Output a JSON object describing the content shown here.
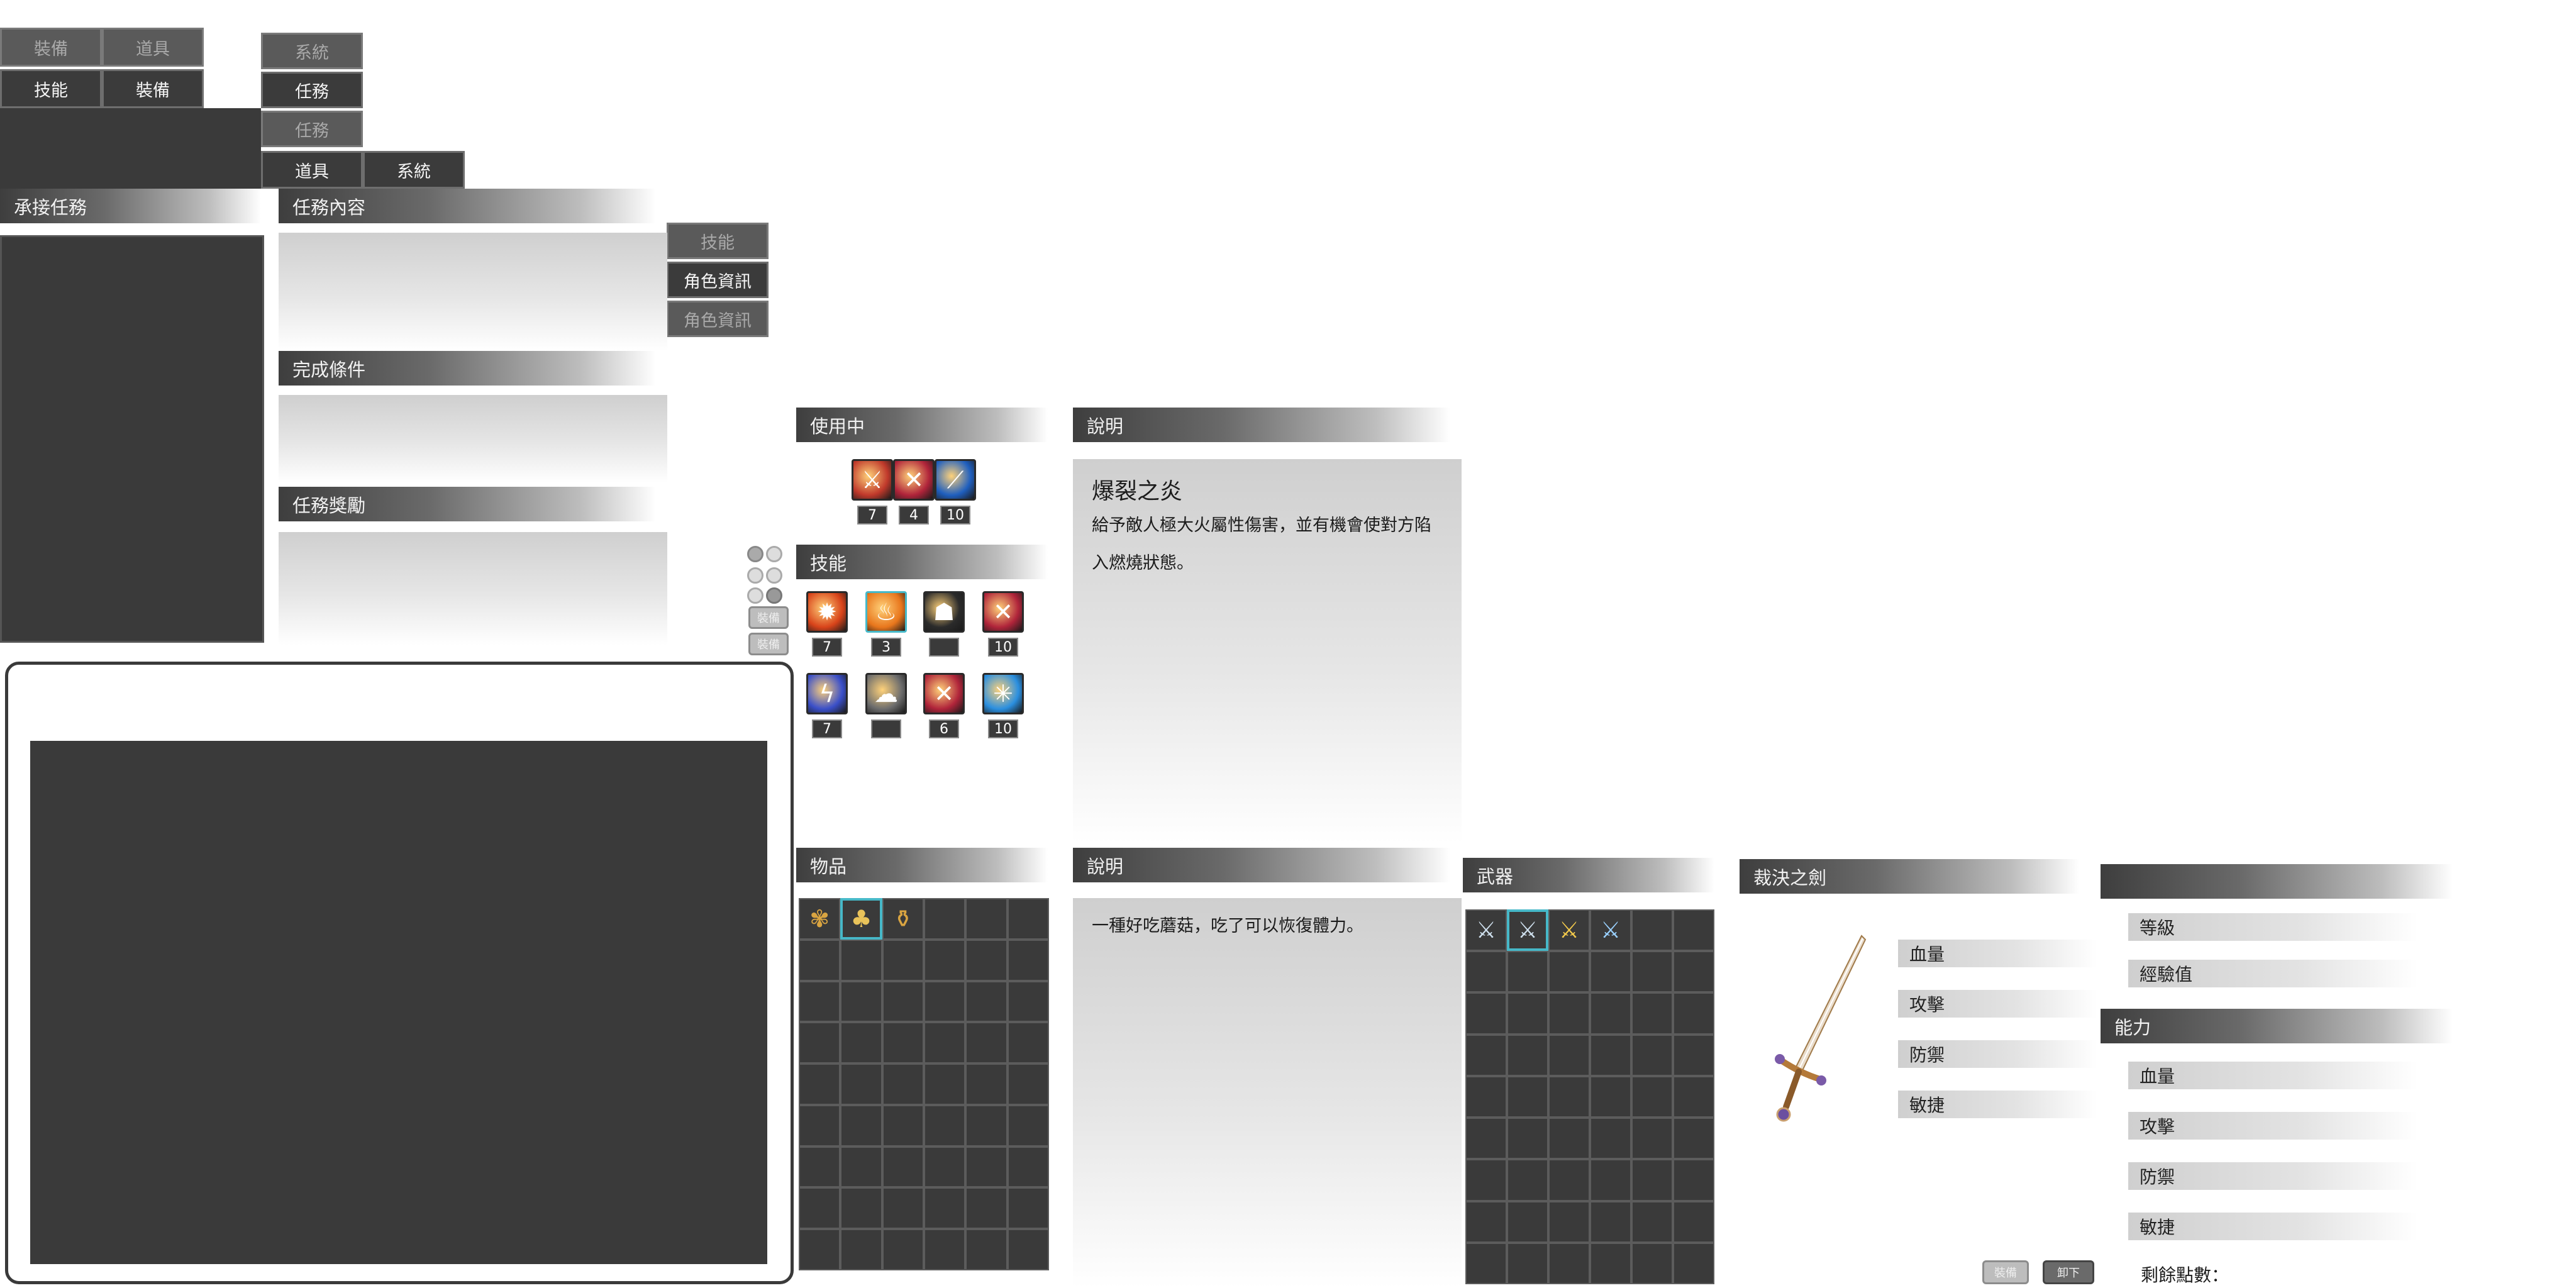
{
  "tabs": {
    "row1_left": "裝備",
    "row1_right": "道具",
    "row2_left": "技能",
    "row2_right": "裝備",
    "sys_top": "系統",
    "task_1": "任務",
    "task_2": "任務",
    "items_tab": "道具",
    "sys_tab": "系統",
    "skill_tab": "技能",
    "char_tab_1": "角色資訊",
    "char_tab_2": "角色資訊"
  },
  "quest": {
    "accepted": "承接任務",
    "content": "任務內容",
    "conditions": "完成條件",
    "rewards": "任務獎勵"
  },
  "skills": {
    "in_use_title": "使用中",
    "skills_title": "技能",
    "desc_title": "說明",
    "selected_name": "爆裂之炎",
    "selected_desc": "給予敵人極大火屬性傷害，並有機會使對方陷入燃燒狀態。",
    "in_use": [
      {
        "icon": "shield-slash-icon",
        "count": "7",
        "color": "#c0392b"
      },
      {
        "icon": "crossed-swords-icon",
        "count": "4",
        "color": "#b0243a"
      },
      {
        "icon": "blue-slash-icon",
        "count": "10",
        "color": "#1f5fbf"
      }
    ],
    "list": [
      {
        "icon": "fireball-icon",
        "count": "7",
        "color": "#d8431a"
      },
      {
        "icon": "flame-burst-icon",
        "count": "3",
        "color": "#e8761c"
      },
      {
        "icon": "shadow-beast-icon",
        "count": "",
        "color": "#2b2b2b"
      },
      {
        "icon": "crossed-swords-icon",
        "count": "10",
        "color": "#b0243a"
      },
      {
        "icon": "lightning-icon",
        "count": "7",
        "color": "#3a4fc9"
      },
      {
        "icon": "smoke-icon",
        "count": "",
        "color": "#6d6d6d"
      },
      {
        "icon": "crossed-swords-icon",
        "count": "6",
        "color": "#b0243a"
      },
      {
        "icon": "ice-burst-icon",
        "count": "10",
        "color": "#2a8fe0"
      }
    ],
    "side_buttons": [
      "裝備",
      "裝備"
    ]
  },
  "items": {
    "title": "物品",
    "desc_title": "說明",
    "selected_desc": "一種好吃蘑菇，吃了可以恢復體力。",
    "slots": [
      {
        "icon": "herb-bundle-icon"
      },
      {
        "icon": "mushroom-icon"
      },
      {
        "icon": "potion-icon"
      }
    ]
  },
  "weapons": {
    "title": "武器",
    "slots": [
      {
        "icon": "sword-icon"
      },
      {
        "icon": "sword-icon"
      },
      {
        "icon": "golden-sword-icon"
      },
      {
        "icon": "ice-sword-icon"
      }
    ],
    "selected_name": "裁決之劍",
    "stats": [
      "血量",
      "攻擊",
      "防禦",
      "敏捷"
    ],
    "btn_equip": "裝備",
    "btn_unequip": "卸下"
  },
  "character": {
    "level": "等級",
    "exp": "經驗值",
    "ability_title": "能力",
    "stats": [
      "血量",
      "攻擊",
      "防禦",
      "敏捷"
    ],
    "remaining_points": "剩餘點數："
  }
}
